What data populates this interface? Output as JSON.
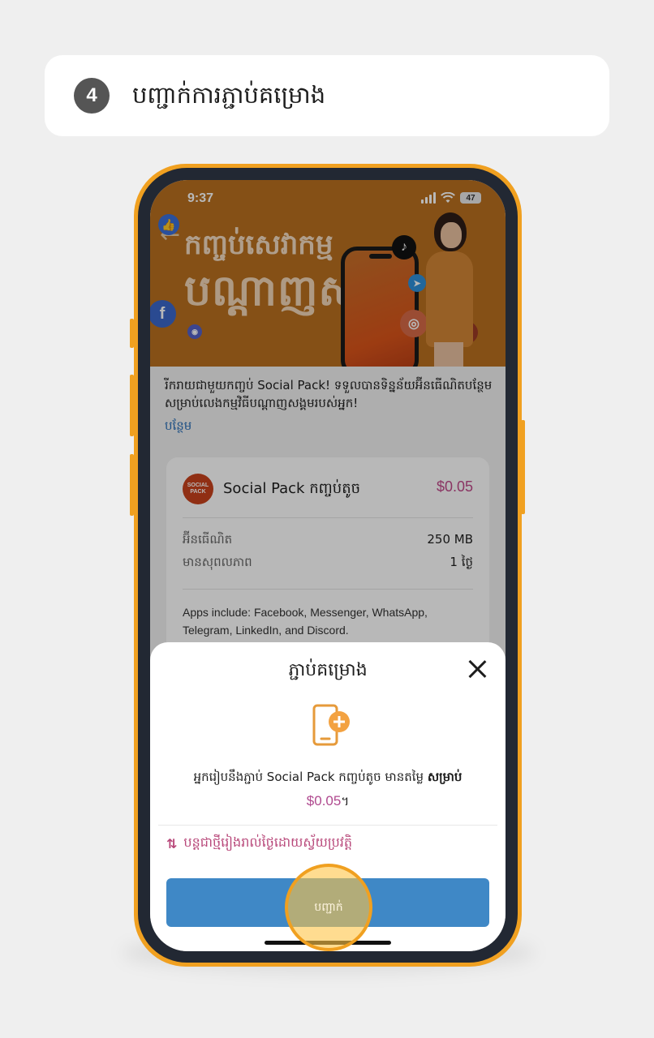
{
  "step": {
    "number": "4",
    "title": "បញ្ជាក់ការភ្ជាប់គម្រោង"
  },
  "status_bar": {
    "time": "9:37",
    "battery": "47"
  },
  "banner": {
    "line1": "កញ្ចប់សេវាកម្ម",
    "line2": "បណ្តាញសង្គម"
  },
  "intro": {
    "text": "រីករាយជាមួយកញ្ចប់ Social Pack! ទទួលបានទិន្នន័យអ៊ីនធើណិតបន្ថែមសម្រាប់លេងកម្មវិធីបណ្តាញសង្គមរបស់អ្នក!",
    "more_link": "បន្ថែម"
  },
  "pack": {
    "logo_text": "SOCIAL PACK",
    "name": "Social Pack កញ្ចប់តូច",
    "price": "$0.05",
    "rows": [
      {
        "label": "អ៊ីនធើណិត",
        "value": "250 MB"
      },
      {
        "label": "មានសុពលភាព",
        "value": "1 ថ្ងៃ"
      }
    ],
    "apps": "Apps include: Facebook, Messenger, WhatsApp, Telegram, LinkedIn, and Discord."
  },
  "sheet": {
    "title": "ភ្ជាប់គម្រោង",
    "message_prefix": "អ្នករៀបនឹងភ្ជាប់ Social Pack កញ្ចប់តូច មានតម្លៃ ",
    "message_bold": "សម្រាប់",
    "price": "$0.05",
    "price_suffix": "។",
    "renew": "បន្តជាថ្មីរៀងរាល់ថ្ងៃដោយស្វ័យប្រវត្តិ",
    "confirm_label": "បញ្ជាក់"
  },
  "colors": {
    "accent_orange": "#f0a020",
    "banner": "#b9701f",
    "confirm_blue": "#3f88c6",
    "price_pink": "#c04a8a"
  },
  "icons": [
    "back-arrow-icon",
    "facebook-icon",
    "tiktok-icon",
    "telegram-icon",
    "instagram-icon",
    "youtube-icon",
    "discord-icon",
    "like-icon",
    "close-icon",
    "add-phone-icon",
    "renew-icon",
    "signal-icon",
    "wifi-icon",
    "battery-icon"
  ]
}
